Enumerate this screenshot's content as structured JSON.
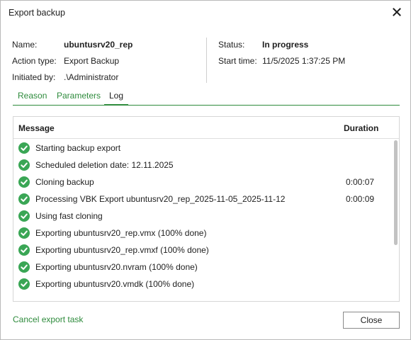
{
  "window": {
    "title": "Export backup"
  },
  "info": {
    "name_label": "Name:",
    "name_value": "ubuntusrv20_rep",
    "action_label": "Action type:",
    "action_value": "Export Backup",
    "initiated_label": "Initiated by:",
    "initiated_value": ".\\Administrator"
  },
  "status": {
    "status_label": "Status:",
    "status_value": "In progress",
    "start_label": "Start time:",
    "start_value": "11/5/2025 1:37:25 PM"
  },
  "tabs": [
    {
      "label": "Reason",
      "active": false
    },
    {
      "label": "Parameters",
      "active": false
    },
    {
      "label": "Log",
      "active": true
    }
  ],
  "log": {
    "header_message": "Message",
    "header_duration": "Duration",
    "status_color": "#3aa655",
    "rows": [
      {
        "message": "Starting backup export",
        "duration": ""
      },
      {
        "message": "Scheduled deletion date: 12.11.2025",
        "duration": ""
      },
      {
        "message": "Cloning backup",
        "duration": "0:00:07"
      },
      {
        "message": "Processing VBK Export ubuntusrv20_rep_2025-11-05_2025-11-12",
        "duration": "0:00:09"
      },
      {
        "message": "Using fast cloning",
        "duration": ""
      },
      {
        "message": "Exporting ubuntusrv20_rep.vmx (100% done)",
        "duration": ""
      },
      {
        "message": "Exporting ubuntusrv20_rep.vmxf (100% done)",
        "duration": ""
      },
      {
        "message": "Exporting ubuntusrv20.nvram (100% done)",
        "duration": ""
      },
      {
        "message": "Exporting ubuntusrv20.vmdk (100% done)",
        "duration": ""
      }
    ]
  },
  "footer": {
    "cancel_label": "Cancel export task",
    "close_label": "Close"
  }
}
